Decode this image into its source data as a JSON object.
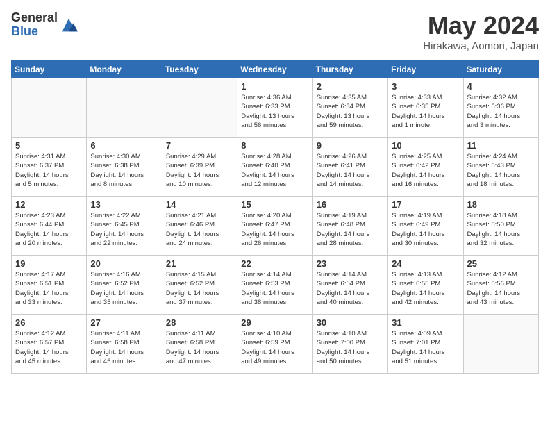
{
  "header": {
    "logo_line1": "General",
    "logo_line2": "Blue",
    "month": "May 2024",
    "location": "Hirakawa, Aomori, Japan"
  },
  "weekdays": [
    "Sunday",
    "Monday",
    "Tuesday",
    "Wednesday",
    "Thursday",
    "Friday",
    "Saturday"
  ],
  "weeks": [
    [
      {
        "day": "",
        "info": "",
        "empty": true
      },
      {
        "day": "",
        "info": "",
        "empty": true
      },
      {
        "day": "",
        "info": "",
        "empty": true
      },
      {
        "day": "1",
        "info": "Sunrise: 4:36 AM\nSunset: 6:33 PM\nDaylight: 13 hours\nand 56 minutes."
      },
      {
        "day": "2",
        "info": "Sunrise: 4:35 AM\nSunset: 6:34 PM\nDaylight: 13 hours\nand 59 minutes."
      },
      {
        "day": "3",
        "info": "Sunrise: 4:33 AM\nSunset: 6:35 PM\nDaylight: 14 hours\nand 1 minute."
      },
      {
        "day": "4",
        "info": "Sunrise: 4:32 AM\nSunset: 6:36 PM\nDaylight: 14 hours\nand 3 minutes."
      }
    ],
    [
      {
        "day": "5",
        "info": "Sunrise: 4:31 AM\nSunset: 6:37 PM\nDaylight: 14 hours\nand 5 minutes."
      },
      {
        "day": "6",
        "info": "Sunrise: 4:30 AM\nSunset: 6:38 PM\nDaylight: 14 hours\nand 8 minutes."
      },
      {
        "day": "7",
        "info": "Sunrise: 4:29 AM\nSunset: 6:39 PM\nDaylight: 14 hours\nand 10 minutes."
      },
      {
        "day": "8",
        "info": "Sunrise: 4:28 AM\nSunset: 6:40 PM\nDaylight: 14 hours\nand 12 minutes."
      },
      {
        "day": "9",
        "info": "Sunrise: 4:26 AM\nSunset: 6:41 PM\nDaylight: 14 hours\nand 14 minutes."
      },
      {
        "day": "10",
        "info": "Sunrise: 4:25 AM\nSunset: 6:42 PM\nDaylight: 14 hours\nand 16 minutes."
      },
      {
        "day": "11",
        "info": "Sunrise: 4:24 AM\nSunset: 6:43 PM\nDaylight: 14 hours\nand 18 minutes."
      }
    ],
    [
      {
        "day": "12",
        "info": "Sunrise: 4:23 AM\nSunset: 6:44 PM\nDaylight: 14 hours\nand 20 minutes."
      },
      {
        "day": "13",
        "info": "Sunrise: 4:22 AM\nSunset: 6:45 PM\nDaylight: 14 hours\nand 22 minutes."
      },
      {
        "day": "14",
        "info": "Sunrise: 4:21 AM\nSunset: 6:46 PM\nDaylight: 14 hours\nand 24 minutes."
      },
      {
        "day": "15",
        "info": "Sunrise: 4:20 AM\nSunset: 6:47 PM\nDaylight: 14 hours\nand 26 minutes."
      },
      {
        "day": "16",
        "info": "Sunrise: 4:19 AM\nSunset: 6:48 PM\nDaylight: 14 hours\nand 28 minutes."
      },
      {
        "day": "17",
        "info": "Sunrise: 4:19 AM\nSunset: 6:49 PM\nDaylight: 14 hours\nand 30 minutes."
      },
      {
        "day": "18",
        "info": "Sunrise: 4:18 AM\nSunset: 6:50 PM\nDaylight: 14 hours\nand 32 minutes."
      }
    ],
    [
      {
        "day": "19",
        "info": "Sunrise: 4:17 AM\nSunset: 6:51 PM\nDaylight: 14 hours\nand 33 minutes."
      },
      {
        "day": "20",
        "info": "Sunrise: 4:16 AM\nSunset: 6:52 PM\nDaylight: 14 hours\nand 35 minutes."
      },
      {
        "day": "21",
        "info": "Sunrise: 4:15 AM\nSunset: 6:52 PM\nDaylight: 14 hours\nand 37 minutes."
      },
      {
        "day": "22",
        "info": "Sunrise: 4:14 AM\nSunset: 6:53 PM\nDaylight: 14 hours\nand 38 minutes."
      },
      {
        "day": "23",
        "info": "Sunrise: 4:14 AM\nSunset: 6:54 PM\nDaylight: 14 hours\nand 40 minutes."
      },
      {
        "day": "24",
        "info": "Sunrise: 4:13 AM\nSunset: 6:55 PM\nDaylight: 14 hours\nand 42 minutes."
      },
      {
        "day": "25",
        "info": "Sunrise: 4:12 AM\nSunset: 6:56 PM\nDaylight: 14 hours\nand 43 minutes."
      }
    ],
    [
      {
        "day": "26",
        "info": "Sunrise: 4:12 AM\nSunset: 6:57 PM\nDaylight: 14 hours\nand 45 minutes."
      },
      {
        "day": "27",
        "info": "Sunrise: 4:11 AM\nSunset: 6:58 PM\nDaylight: 14 hours\nand 46 minutes."
      },
      {
        "day": "28",
        "info": "Sunrise: 4:11 AM\nSunset: 6:58 PM\nDaylight: 14 hours\nand 47 minutes."
      },
      {
        "day": "29",
        "info": "Sunrise: 4:10 AM\nSunset: 6:59 PM\nDaylight: 14 hours\nand 49 minutes."
      },
      {
        "day": "30",
        "info": "Sunrise: 4:10 AM\nSunset: 7:00 PM\nDaylight: 14 hours\nand 50 minutes."
      },
      {
        "day": "31",
        "info": "Sunrise: 4:09 AM\nSunset: 7:01 PM\nDaylight: 14 hours\nand 51 minutes."
      },
      {
        "day": "",
        "info": "",
        "empty": true
      }
    ]
  ]
}
